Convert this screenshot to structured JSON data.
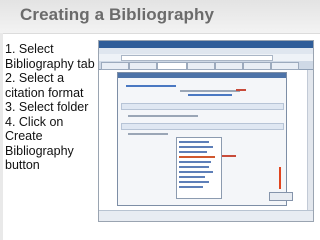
{
  "slide": {
    "title": "Creating a Bibliography",
    "steps": [
      "1. Select Bibliography tab",
      "2. Select a citation format",
      "3. Select folder",
      "4. Click on Create Bibliography button"
    ]
  },
  "colors": {
    "title": "#6b6b6b",
    "body_text": "#111111",
    "annotation_arrow": "#e0451f",
    "dialog_header": "#4d73a8"
  }
}
